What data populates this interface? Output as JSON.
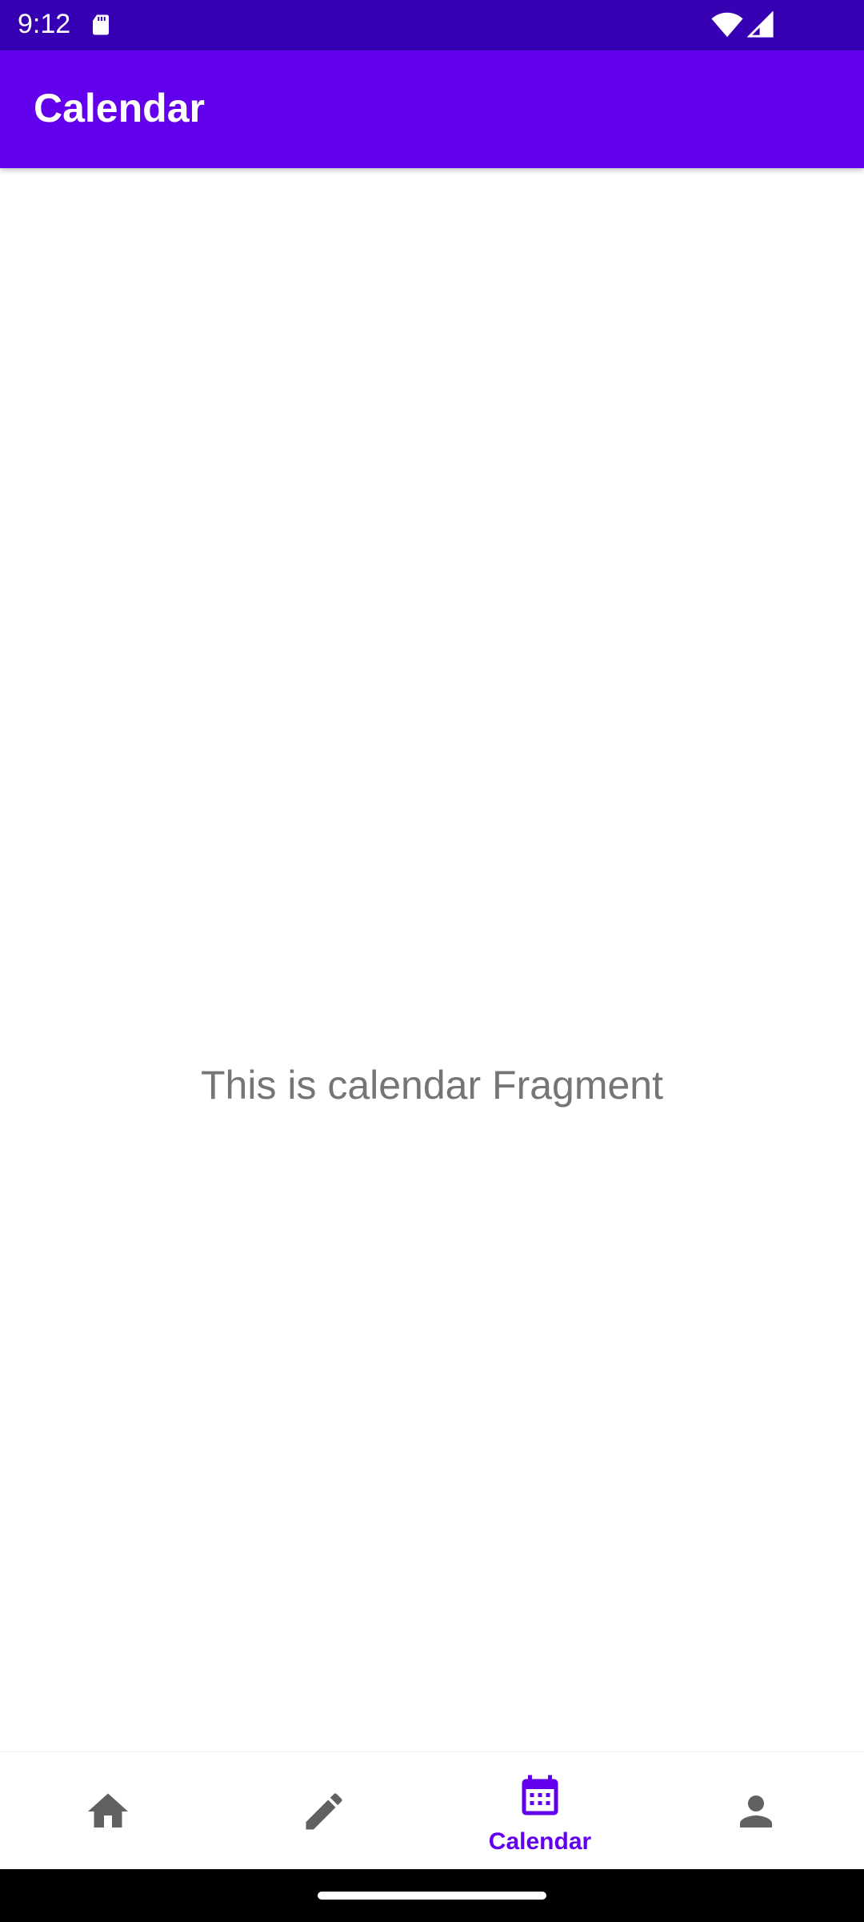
{
  "status_bar": {
    "time": "9:12",
    "background": "#3700b3",
    "icons": [
      "sd-card-icon",
      "wifi-icon",
      "signal-icon"
    ]
  },
  "app_bar": {
    "title": "Calendar",
    "background": "#6200ee"
  },
  "content": {
    "message": "This is calendar Fragment"
  },
  "bottom_nav": {
    "accent": "#6200ee",
    "inactive_color": "#616161",
    "items": [
      {
        "icon": "home-icon",
        "label": "",
        "active": false
      },
      {
        "icon": "pencil-icon",
        "label": "",
        "active": false
      },
      {
        "icon": "calendar-icon",
        "label": "Calendar",
        "active": true
      },
      {
        "icon": "person-icon",
        "label": "",
        "active": false
      }
    ]
  }
}
